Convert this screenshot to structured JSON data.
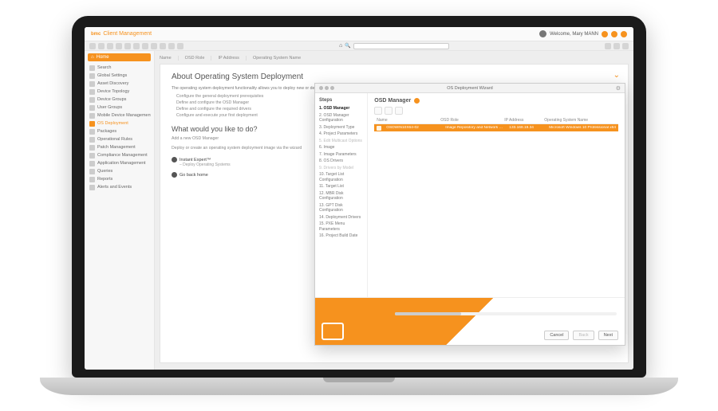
{
  "header": {
    "brand_small": "bmc",
    "brand": "Client Management",
    "welcome": "Welcome, Mary MANN"
  },
  "crumbs": [
    "Name",
    "OSD Role",
    "IP Address",
    "Operating System Name"
  ],
  "sidebar": {
    "home": "Home",
    "items": [
      {
        "label": "Search"
      },
      {
        "label": "Global Settings"
      },
      {
        "label": "Asset Discovery"
      },
      {
        "label": "Device Topology"
      },
      {
        "label": "Device Groups"
      },
      {
        "label": "User Groups"
      },
      {
        "label": "Mobile Device Management"
      },
      {
        "label": "OS Deployment",
        "active": true
      },
      {
        "label": "Packages"
      },
      {
        "label": "Operational Rules"
      },
      {
        "label": "Patch Management"
      },
      {
        "label": "Compliance Management"
      },
      {
        "label": "Application Management"
      },
      {
        "label": "Queries"
      },
      {
        "label": "Reports"
      },
      {
        "label": "Alerts and Events"
      }
    ]
  },
  "page": {
    "title": "About Operating System Deployment",
    "desc": "The operating system deployment functionality allows you to deploy new or deploy or repair already installed operating systems on your devices. The main steps of this process are:",
    "bullets": [
      "Configure the general deployment prerequisites",
      "Define and configure the OSD Manager",
      "Define and configure the required drivers",
      "Configure and execute your first deployment"
    ],
    "subtitle": "What would you like to do?",
    "link1": "Add a new OSD Manager",
    "link2": "Deploy or create an operating system deployment image via the wizard",
    "expert_label": "Instant Expert™",
    "expert_sub": "– Deploy Operating Systems",
    "go_home": "Go back home"
  },
  "wizard": {
    "title": "OS Deployment Wizard",
    "steps_title": "Steps",
    "steps": [
      {
        "label": "1. OSD Manager",
        "state": "active"
      },
      {
        "label": "2. OSD Manager Configuration"
      },
      {
        "label": "3. Deployment Type"
      },
      {
        "label": "4. Project Parameters"
      },
      {
        "label": "5. Edit Multicast Options",
        "state": "disabled"
      },
      {
        "label": "6. Image"
      },
      {
        "label": "7. Image Parameters"
      },
      {
        "label": "8. OS Drivers"
      },
      {
        "label": "9. Drivers by Model",
        "state": "disabled"
      },
      {
        "label": "10. Target List Configuration"
      },
      {
        "label": "11. Target List"
      },
      {
        "label": "12. MBR Disk Configuration"
      },
      {
        "label": "13. GPT Disk Configuration"
      },
      {
        "label": "14. Deployment Drivers"
      },
      {
        "label": "15. PXE Menu Parameters"
      },
      {
        "label": "16. Project Build Date"
      }
    ],
    "main_title": "OSD Manager",
    "columns": {
      "c1": "Name",
      "c2": "OSD Role",
      "c3": "IP Address",
      "c4": "Operating System Name"
    },
    "row": {
      "name": "OSDWIN10X64-02",
      "role": "Image Repository and Network Boot Listener",
      "ip": "133.168.19.34",
      "os": "Microsoft Windows 10 Professional x64"
    },
    "buttons": {
      "cancel": "Cancel",
      "back": "Back",
      "next": "Next"
    }
  }
}
